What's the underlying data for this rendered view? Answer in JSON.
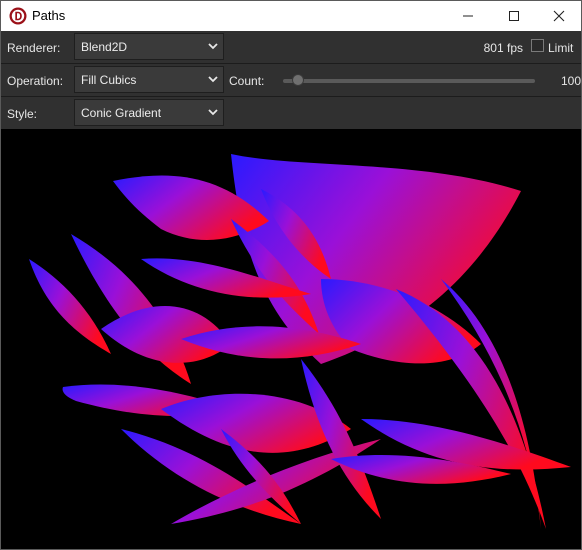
{
  "window": {
    "title": "Paths"
  },
  "icons": {
    "app": "app-logo-icon",
    "minimize": "minimize-icon",
    "maximize": "maximize-icon",
    "close": "close-icon",
    "dropdown": "chevron-down-icon"
  },
  "toolbar": {
    "renderer_label": "Renderer:",
    "renderer_value": "Blend2D",
    "fps_text": "801 fps",
    "limit_label": "Limit",
    "limit_checked": false,
    "operation_label": "Operation:",
    "operation_value": "Fill Cubics",
    "count_label": "Count:",
    "count_value": "100",
    "count_slider_fraction": 0.06,
    "style_label": "Style:",
    "style_value": "Conic Gradient"
  },
  "colors": {
    "gradient_start": "#2a1aff",
    "gradient_mid": "#9a10d8",
    "gradient_end": "#ff0a1e",
    "toolbar_bg": "#303030",
    "canvas_bg": "#000000"
  }
}
